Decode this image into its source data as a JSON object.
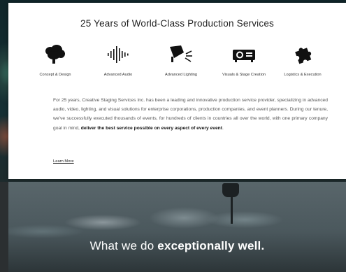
{
  "card": {
    "title": "25 Years of World-Class Production Services",
    "services": [
      {
        "label": "Concept & Design",
        "icon": "brain-icon"
      },
      {
        "label": "Advanced Audio",
        "icon": "audio-waveform-icon"
      },
      {
        "label": "Advanced Lighting",
        "icon": "spotlight-icon"
      },
      {
        "label": "Visuals & Stage Creation",
        "icon": "projector-icon"
      },
      {
        "label": "Logistics & Execution",
        "icon": "puzzle-piece-icon"
      }
    ],
    "paragraph": {
      "text": "For 25 years, Creative Staging Services Inc. has been a leading and innovative production service provider, specializing in advanced audio, video, lighting, and visual solutions for enterprise corporations, production companies, and event planners.  During our tenure, we’ve successfully executed thousands of events, for hundreds of clients in countries all over the world, with one primary company goal in mind, ",
      "emphasis": "deliver the best service possible on every aspect of every event",
      "end": "."
    },
    "learn_more": "Learn More"
  },
  "hero": {
    "text_normal": "What we do ",
    "text_bold": "exceptionally well."
  }
}
